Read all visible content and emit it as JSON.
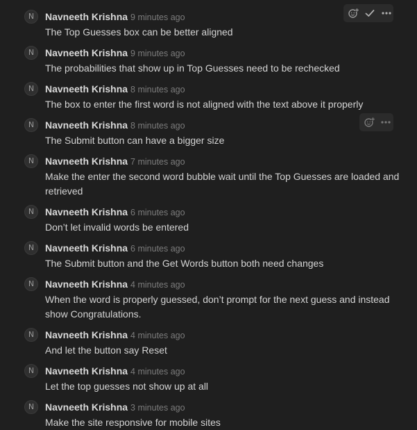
{
  "comments": [
    {
      "avatar": "N",
      "author": "Navneeth Krishna",
      "time": "9 minutes ago",
      "text": "The Top Guesses box can be better aligned"
    },
    {
      "avatar": "N",
      "author": "Navneeth Krishna",
      "time": "9 minutes ago",
      "text": "The probabilities that show up in Top Guesses need to be rechecked"
    },
    {
      "avatar": "N",
      "author": "Navneeth Krishna",
      "time": "8 minutes ago",
      "text": "The box to enter the first word is not aligned with the text above it properly"
    },
    {
      "avatar": "N",
      "author": "Navneeth Krishna",
      "time": "8 minutes ago",
      "text": "The Submit button can have a bigger size"
    },
    {
      "avatar": "N",
      "author": "Navneeth Krishna",
      "time": "7 minutes ago",
      "text": "Make the enter the second word bubble wait until the Top Guesses are loaded and retrieved"
    },
    {
      "avatar": "N",
      "author": "Navneeth Krishna",
      "time": "6 minutes ago",
      "text": "Don’t let invalid words be entered"
    },
    {
      "avatar": "N",
      "author": "Navneeth Krishna",
      "time": "6 minutes ago",
      "text": "The Submit button and the Get Words button both need changes"
    },
    {
      "avatar": "N",
      "author": "Navneeth Krishna",
      "time": "4 minutes ago",
      "text": "When the word is properly guessed, don’t prompt for the next guess and instead show Congratulations."
    },
    {
      "avatar": "N",
      "author": "Navneeth Krishna",
      "time": "4 minutes ago",
      "text": "And let the button say Reset"
    },
    {
      "avatar": "N",
      "author": "Navneeth Krishna",
      "time": "4 minutes ago",
      "text": "Let the top guesses not show up at all"
    },
    {
      "avatar": "N",
      "author": "Navneeth Krishna",
      "time": "3 minutes ago",
      "text": "Make the site responsive for mobile sites"
    }
  ],
  "actions": {
    "top": [
      "add-reaction-icon",
      "resolve-check-icon",
      "more-options-icon"
    ],
    "hover": [
      "add-reaction-icon",
      "more-options-icon"
    ]
  },
  "colors": {
    "background": "#1f1f1f",
    "author": "#d9d9d9",
    "timestamp": "#7c7c7c",
    "text": "#d4d4d4",
    "toolbar": "#2b2b2b"
  }
}
